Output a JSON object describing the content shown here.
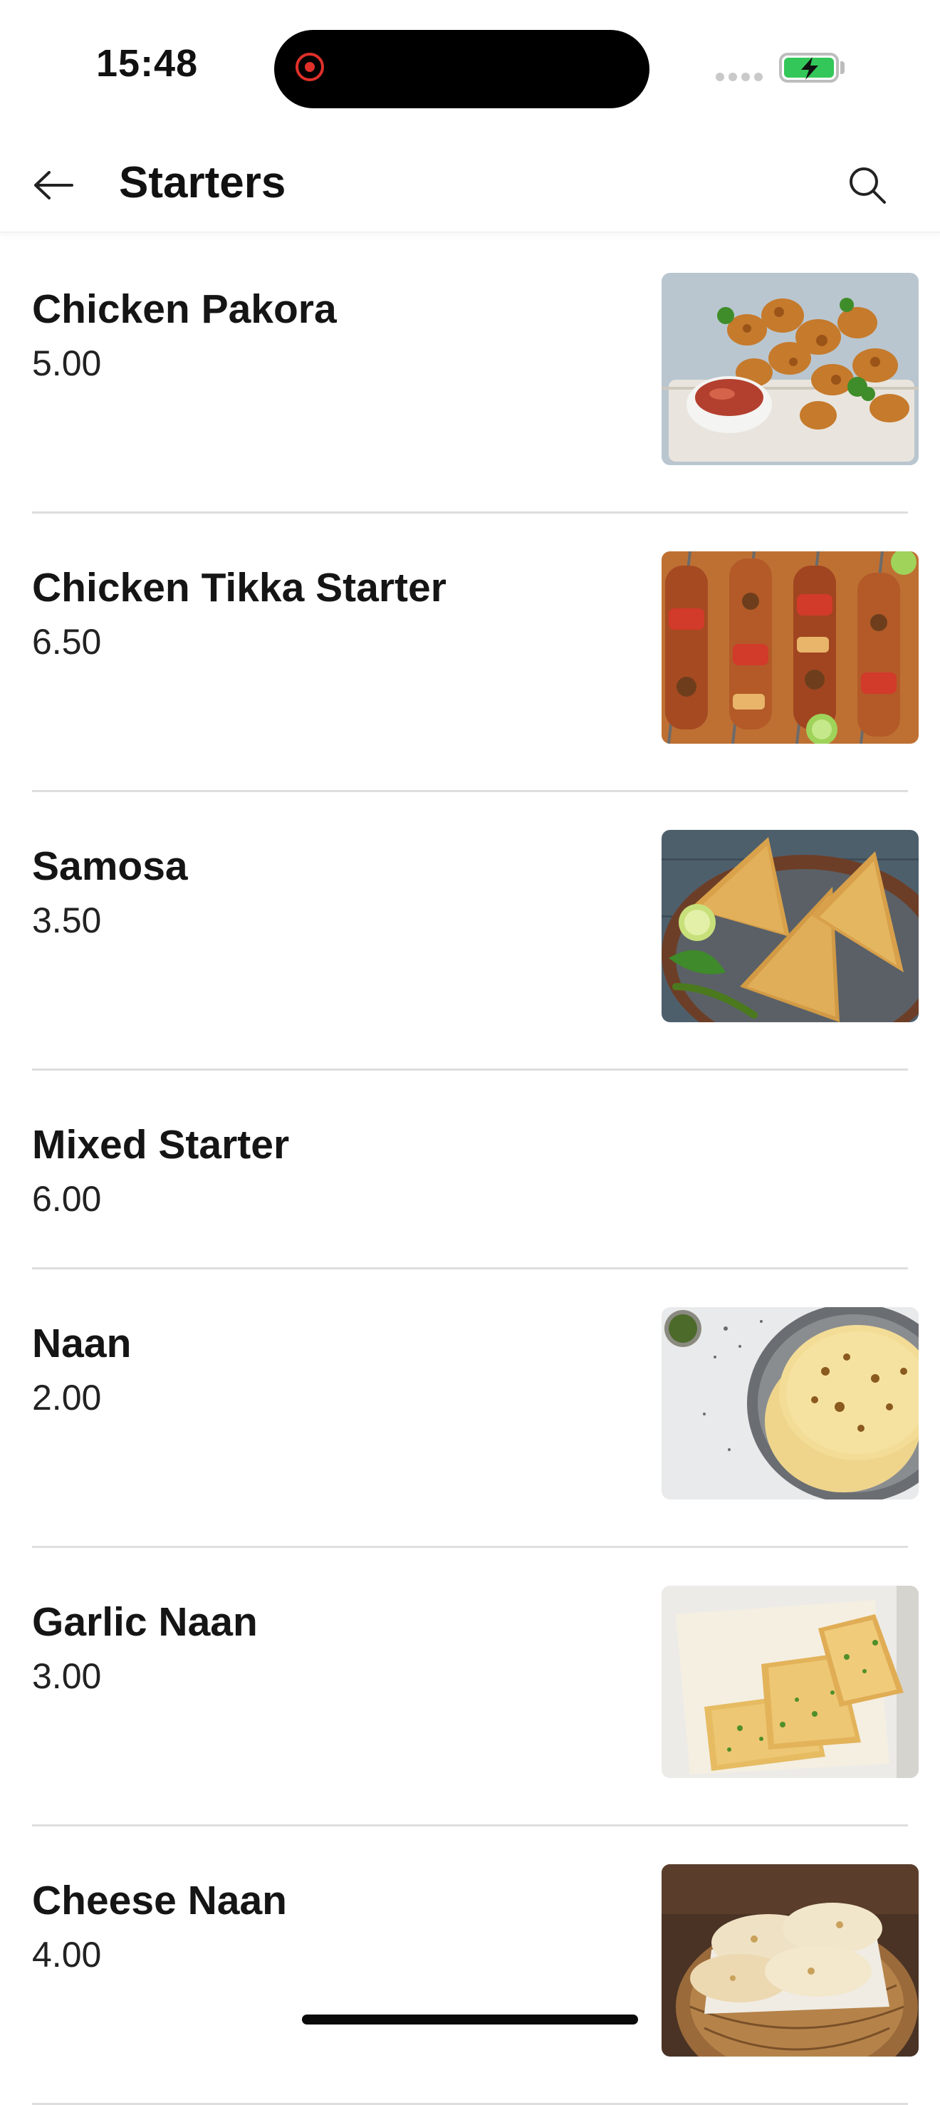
{
  "status_bar": {
    "time": "15:48"
  },
  "header": {
    "title": "Starters",
    "back_icon": "arrow-left-icon",
    "search_icon": "search-icon"
  },
  "menu": {
    "items": [
      {
        "name": "Chicken Pakora",
        "price": "5.00",
        "has_image": true
      },
      {
        "name": "Chicken Tikka Starter",
        "price": "6.50",
        "has_image": true
      },
      {
        "name": "Samosa",
        "price": "3.50",
        "has_image": true
      },
      {
        "name": "Mixed Starter",
        "price": "6.00",
        "has_image": false
      },
      {
        "name": "Naan",
        "price": "2.00",
        "has_image": true
      },
      {
        "name": "Garlic Naan",
        "price": "3.00",
        "has_image": true
      },
      {
        "name": "Cheese Naan",
        "price": "4.00",
        "has_image": true
      }
    ]
  },
  "colors": {
    "recording_red": "#e0302a",
    "battery_green": "#33c759",
    "divider": "#dedede"
  }
}
